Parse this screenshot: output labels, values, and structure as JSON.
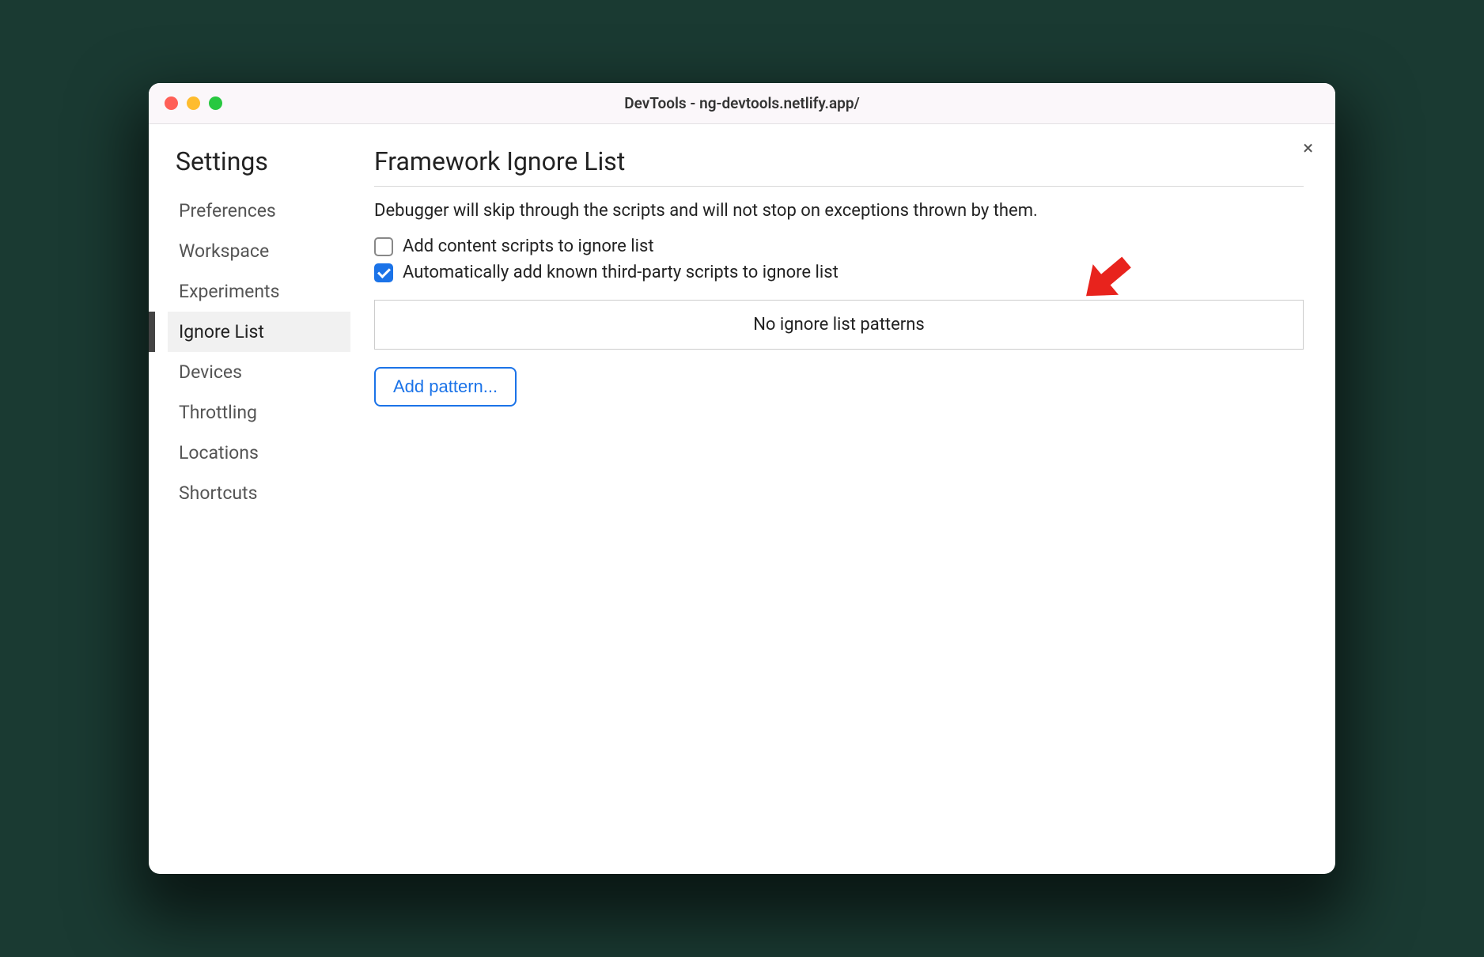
{
  "window": {
    "title": "DevTools - ng-devtools.netlify.app/"
  },
  "sidebar": {
    "title": "Settings",
    "items": [
      {
        "label": "Preferences",
        "active": false
      },
      {
        "label": "Workspace",
        "active": false
      },
      {
        "label": "Experiments",
        "active": false
      },
      {
        "label": "Ignore List",
        "active": true
      },
      {
        "label": "Devices",
        "active": false
      },
      {
        "label": "Throttling",
        "active": false
      },
      {
        "label": "Locations",
        "active": false
      },
      {
        "label": "Shortcuts",
        "active": false
      }
    ]
  },
  "panel": {
    "title": "Framework Ignore List",
    "description": "Debugger will skip through the scripts and will not stop on exceptions thrown by them.",
    "checkboxes": [
      {
        "label": "Add content scripts to ignore list",
        "checked": false
      },
      {
        "label": "Automatically add known third-party scripts to ignore list",
        "checked": true
      }
    ],
    "empty_text": "No ignore list patterns",
    "add_button_label": "Add pattern...",
    "close_label": "×"
  }
}
